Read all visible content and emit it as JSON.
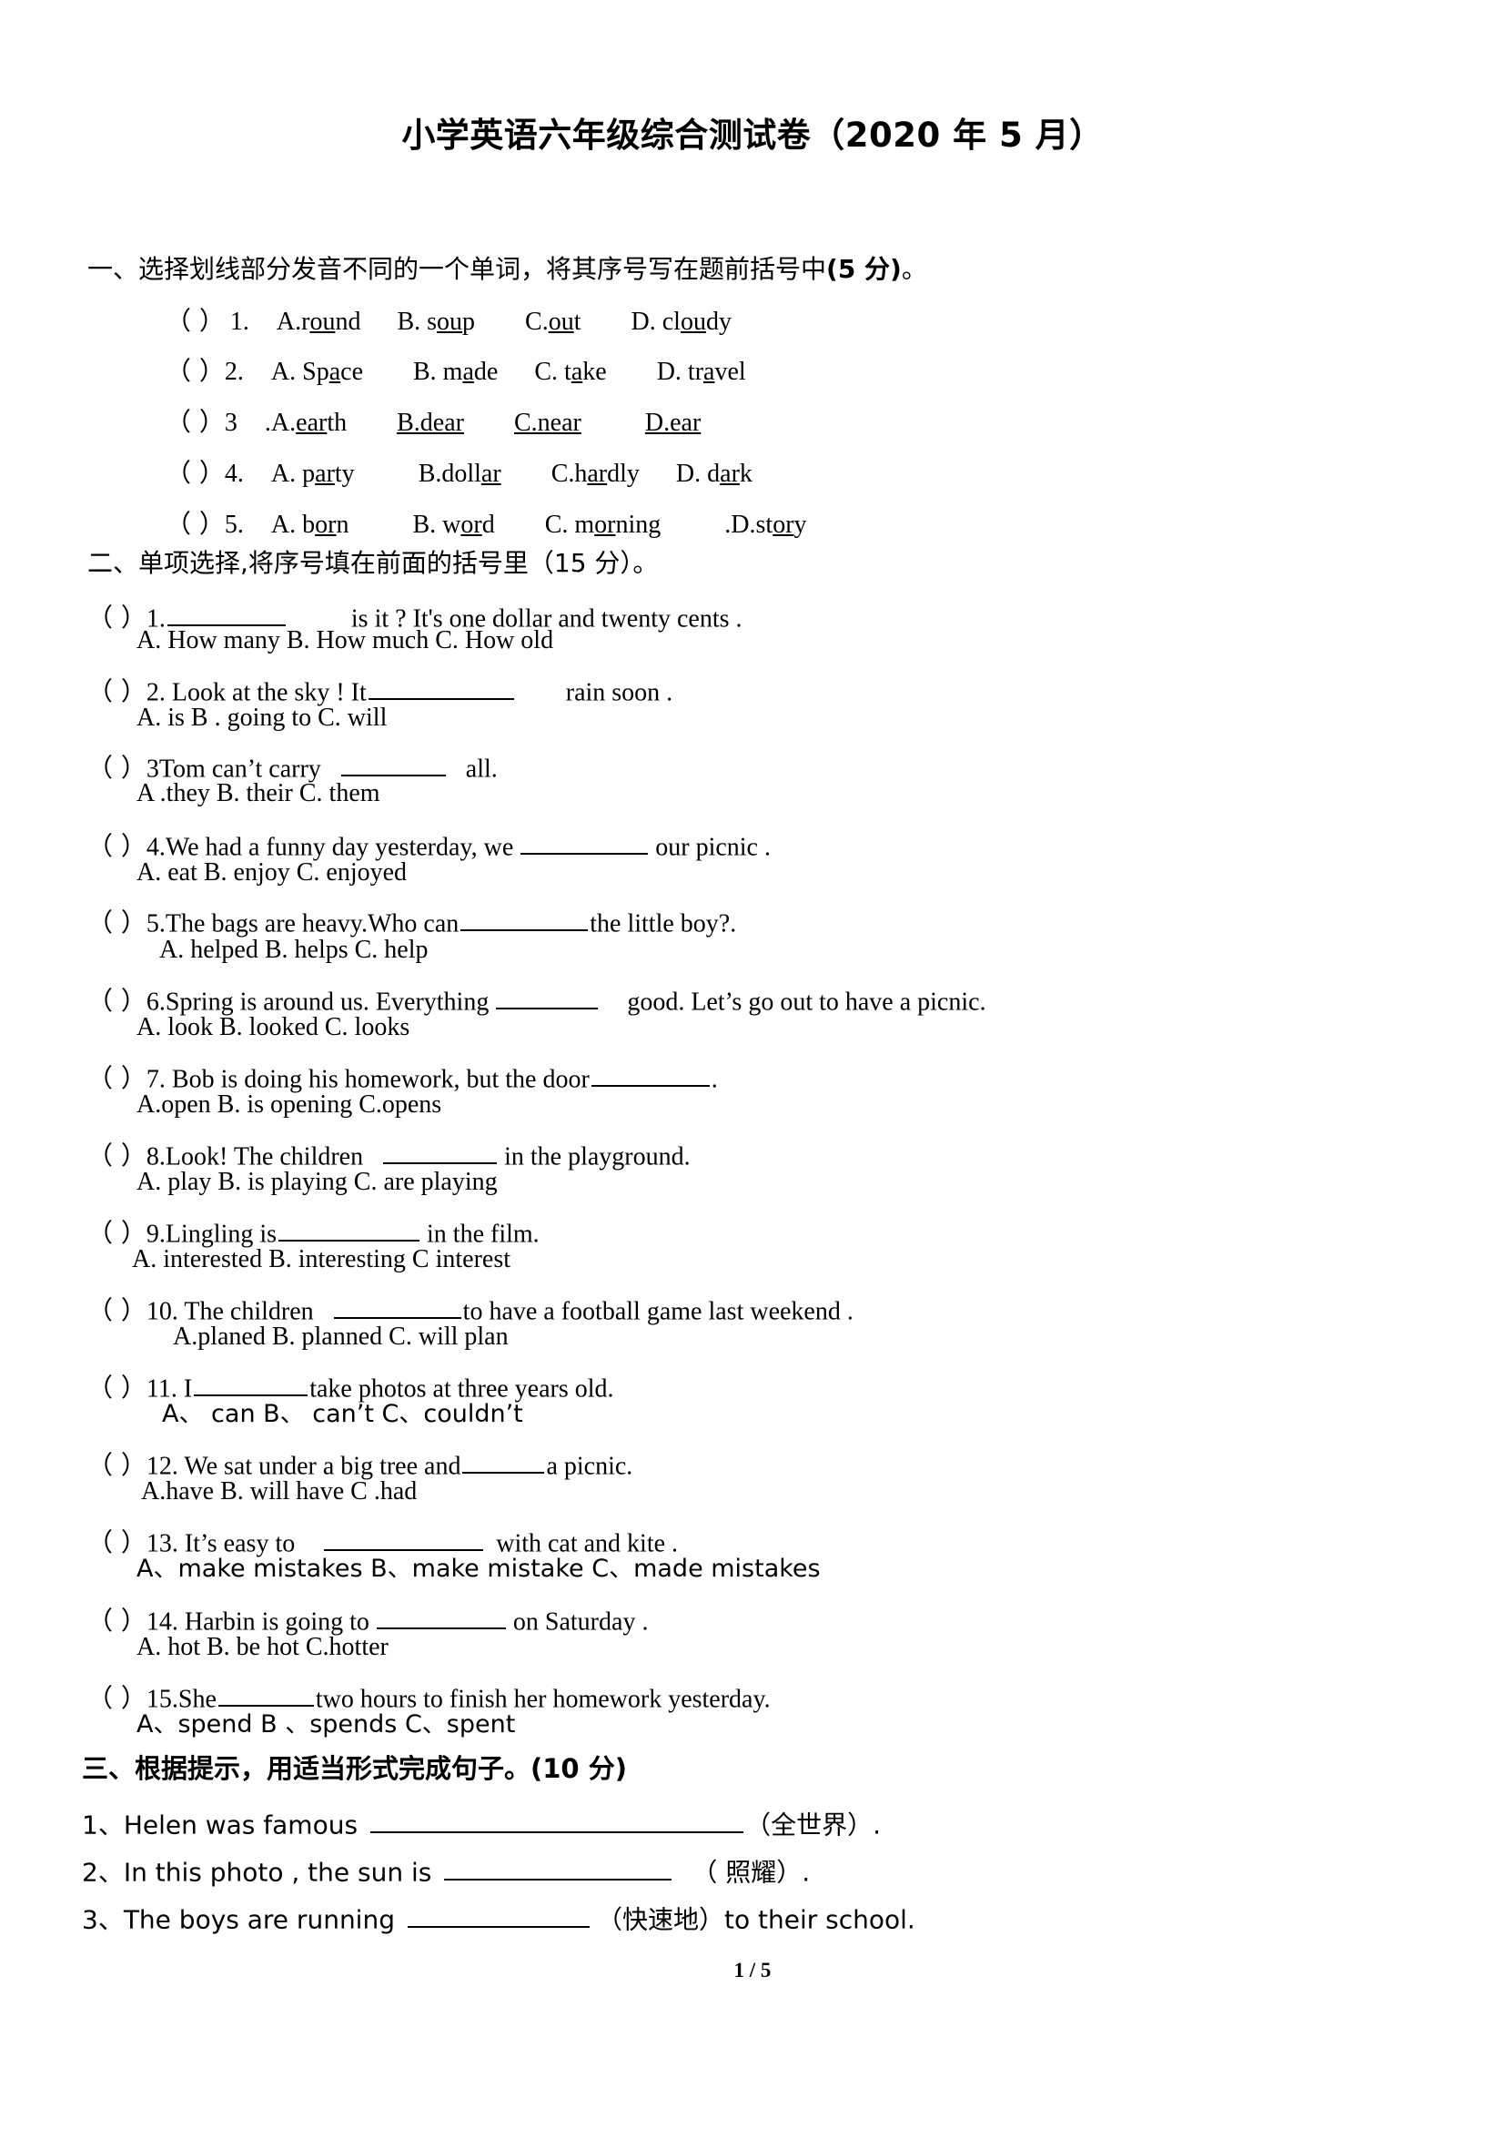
{
  "document": {
    "title": "小学英语六年级综合测试卷（2020 年 5 月）",
    "footer": "1 / 5"
  },
  "section1": {
    "heading_prefix": "一、选择划线部分发音不同的一个单词，将其序号写在题前括号中",
    "heading_score": "(5 分)",
    "heading_suffix": "。",
    "items": [
      {
        "bracket": "（    ）",
        "number": "1.",
        "options": [
          {
            "pre": "A.r",
            "mid": "ou",
            "post": "nd"
          },
          {
            "pre": "B. s",
            "mid": "ou",
            "post": "p"
          },
          {
            "pre": "C.",
            "mid": "ou",
            "post": "t"
          },
          {
            "pre": "D. cl",
            "mid": "ou",
            "post": "dy"
          }
        ]
      },
      {
        "bracket": "（    ）",
        "number": "2.",
        "options": [
          {
            "pre": "A. Sp",
            "mid": "a",
            "post": "ce"
          },
          {
            "pre": "B. m",
            "mid": "a",
            "post": "de"
          },
          {
            "pre": "C. t",
            "mid": "a",
            "post": "ke"
          },
          {
            "pre": "D. tr",
            "mid": "a",
            "post": "vel"
          }
        ]
      },
      {
        "bracket": "（    ）",
        "number": "3",
        "options": [
          {
            "pre": ".A.",
            "mid": "ear",
            "post": "th"
          },
          {
            "pre": "B.d",
            "mid": "ear",
            "post": ""
          },
          {
            "pre": "C.n",
            "mid": "ear",
            "post": ""
          },
          {
            "pre": "D.",
            "mid": "ear",
            "post": ""
          }
        ]
      },
      {
        "bracket": "（    ）",
        "number": "4.",
        "options": [
          {
            "pre": "A. p",
            "mid": "ar",
            "post": "ty"
          },
          {
            "pre": "B.doll",
            "mid": "ar",
            "post": ""
          },
          {
            "pre": "C.h",
            "mid": "ar",
            "post": "dly"
          },
          {
            "pre": "D. d",
            "mid": "ar",
            "post": "k"
          }
        ]
      },
      {
        "bracket": "（    ）",
        "number": "5.",
        "options": [
          {
            "pre": "A. b",
            "mid": "or",
            "post": "n"
          },
          {
            "pre": "B. w",
            "mid": "or",
            "post": "d"
          },
          {
            "pre": "C. m",
            "mid": "or",
            "post": "ning"
          },
          {
            "pre": ".D.st",
            "mid": "or",
            "post": "y"
          }
        ]
      }
    ]
  },
  "section2": {
    "heading": "二、单项选择,将序号填在前面的括号里（15 分）。",
    "items": [
      {
        "bracket": "（    ）",
        "stem_pre": "1.",
        "stem_post": "is it ? It's one dollar and twenty cents .",
        "options": "A. How many          B. How much          C. How old"
      },
      {
        "bracket": "（    ）",
        "stem_pre": "2. Look at the sky ! It",
        "stem_post": "rain soon .",
        "options": "A. is      B . going to        C. will"
      },
      {
        "bracket": "（    ）",
        "stem_pre": "3Tom can’t carry",
        "stem_post": "all.",
        "options": "A .they     B. their    C. them"
      },
      {
        "bracket": "（    ）",
        "stem_pre": "4.We had a funny day yesterday, we",
        "stem_post": "our picnic .",
        "options": "A. eat            B. enjoy     C. enjoyed"
      },
      {
        "bracket": "（    ）",
        "stem_pre": "5.The bags are heavy.Who can",
        "stem_post": "the little boy?.",
        "options": "A. helped     B. helps      C. help"
      },
      {
        "bracket": "（    ）",
        "stem_pre": "6.Spring is around us. Everything",
        "stem_post": "good. Let’s    go out to have a picnic.",
        "options": "A. look     B. looked     C. looks"
      },
      {
        "bracket": "（    ）",
        "stem_pre": "7. Bob is doing his homework, but the door",
        "stem_post": ".",
        "options": "A.open              B. is opening        C.opens"
      },
      {
        "bracket": "（    ）",
        "stem_pre": "8.Look! The children",
        "stem_post": "in the playground.",
        "options": "A. play            B. is playing          C. are playing"
      },
      {
        "bracket": "（    ）",
        "stem_pre": "9.Lingling is",
        "stem_post": "in the film.",
        "options": "A. interested             B. interesting        C    interest"
      },
      {
        "bracket": "（    ）",
        "stem_pre": "10. The children",
        "stem_post": "to have a football game last weekend .",
        "options": "A.planed     B. planned      C. will plan"
      },
      {
        "bracket": "（    ）",
        "stem_pre": "11. I",
        "stem_post": "take photos   at three years old.",
        "options": "A、   can        B、   can’t      C、couldn’t"
      },
      {
        "bracket": "（    ）",
        "stem_pre": "12. We sat under   a big tree and",
        "stem_post": "a picnic.",
        "options": "A.have        B. will have         C .had"
      },
      {
        "bracket": "（    ）",
        "stem_pre": "13. It’s easy to",
        "stem_post": "with cat and kite .",
        "options": "A、make mistakes      B、make mistake     C、made mistakes"
      },
      {
        "bracket": "（    ）",
        "stem_pre": "14. Harbin is going to",
        "stem_post": "on Saturday .",
        "options": "A. hot           B. be hot        C.hotter"
      },
      {
        "bracket": "（    ）",
        "stem_pre": "15.She",
        "stem_post": "two hours to finish her homework yesterday.",
        "options": "A、spend      B 、spends   C、spent"
      }
    ]
  },
  "section3": {
    "heading": "三、根据提示，用适当形式完成句子。(10 分)",
    "items": [
      {
        "pre": "1、Helen was famous",
        "post": "（全世界）."
      },
      {
        "pre": "2、In this photo , the sun is",
        "post": "（ 照耀）."
      },
      {
        "pre": "3、The boys are running",
        "post": "（快速地）to their school."
      }
    ]
  }
}
